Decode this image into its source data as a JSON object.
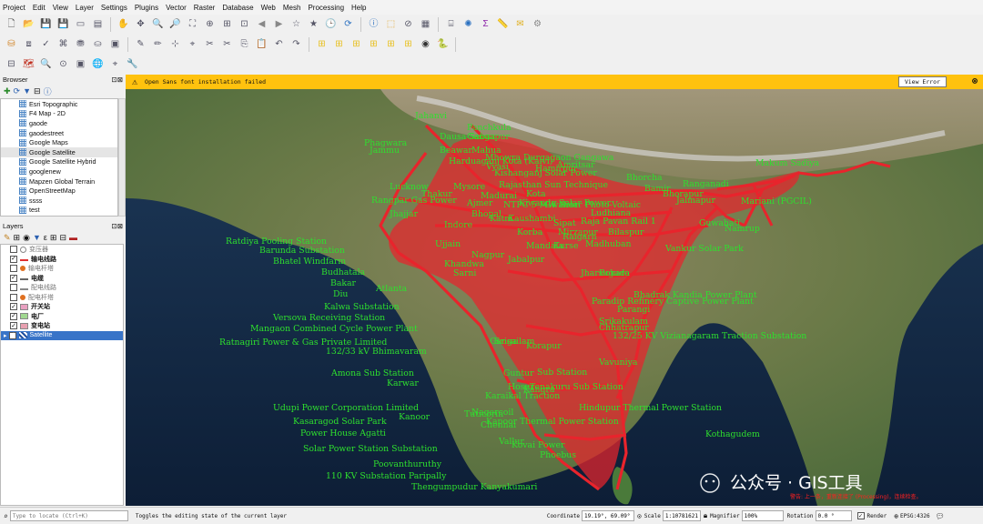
{
  "menubar": [
    "Project",
    "Edit",
    "View",
    "Layer",
    "Settings",
    "Plugins",
    "Vector",
    "Raster",
    "Database",
    "Web",
    "Mesh",
    "Processing",
    "Help"
  ],
  "toolbars": {
    "row1": [
      "new-project-icon",
      "open-project-icon",
      "save-project-icon",
      "save-as-icon",
      "print-layout-icon",
      "layout-manager-icon",
      "sep",
      "pan-icon",
      "pan-to-selection-icon",
      "zoom-in-icon",
      "zoom-out-icon",
      "zoom-full-icon",
      "zoom-to-selection-icon",
      "zoom-to-layer-icon",
      "zoom-native-icon",
      "zoom-last-icon",
      "zoom-next-icon",
      "new-bookmark-icon",
      "show-bookmarks-icon",
      "temporal-controller-icon",
      "refresh-icon",
      "sep",
      "identify-icon",
      "select-features-icon",
      "deselect-icon",
      "attribute-table-icon",
      "sep",
      "field-calculator-icon",
      "statistics-icon",
      "sum-icon",
      "measure-icon",
      "annotation-icon",
      "map-tips-icon"
    ],
    "row2": [
      "data-source-manager-icon",
      "new-geopackage-icon",
      "digitize-icon",
      "new-shapefile-icon",
      "new-spatialite-icon",
      "new-virtual-layer-icon",
      "new-temp-layer-icon",
      "sep",
      "edit-pencil-icon",
      "toggle-editing-icon",
      "add-feature-icon",
      "vertex-tool-icon",
      "delete-selected-icon",
      "cut-icon",
      "copy-icon",
      "paste-icon",
      "undo-icon",
      "redo-icon",
      "sep",
      "label-icon",
      "label-pin-icon",
      "label-move-icon",
      "label-rotate-icon",
      "label-show-icon",
      "label-change-icon",
      "globe-icon",
      "python-icon",
      "sep"
    ],
    "row3": [
      "georeferencer-icon",
      "quickmap-icon",
      "zoom-tool-icon",
      "zoom-fit-icon",
      "select-icon",
      "globe-settings-icon",
      "gps-icon",
      "tools-icon"
    ]
  },
  "message": {
    "text": "Open Sans font installation failed",
    "button": "View Error"
  },
  "browser": {
    "title": "Browser",
    "items": [
      "Esri Topographic",
      "F4 Map - 2D",
      "gaode",
      "gaodestreet",
      "Google Maps",
      "Google Satellite",
      "Google Satellite Hybrid",
      "googlenew",
      "Mapzen Global Terrain",
      "OpenStreetMap",
      "ssss",
      "test"
    ],
    "selected": "Google Satellite"
  },
  "layers": {
    "title": "Layers",
    "items": [
      {
        "name": "变压器",
        "checked": false,
        "symbol": "circle",
        "color": "#888888",
        "dim": true
      },
      {
        "name": "输电线路",
        "checked": true,
        "symbol": "line",
        "color": "#e03030",
        "dim": false
      },
      {
        "name": "输电杆塔",
        "checked": false,
        "symbol": "dot",
        "color": "#e07020",
        "dim": true
      },
      {
        "name": "电缆",
        "checked": true,
        "symbol": "dash",
        "color": "#666666",
        "dim": false
      },
      {
        "name": "配电线路",
        "checked": false,
        "symbol": "line",
        "color": "#888888",
        "dim": true
      },
      {
        "name": "配电杆塔",
        "checked": false,
        "symbol": "dot",
        "color": "#e07020",
        "dim": true
      },
      {
        "name": "开关站",
        "checked": true,
        "symbol": "fill",
        "color": "#e8a0c0",
        "dim": false
      },
      {
        "name": "电厂",
        "checked": true,
        "symbol": "fill",
        "color": "#a0d890",
        "dim": false
      },
      {
        "name": "变电站",
        "checked": true,
        "symbol": "fill",
        "color": "#e8a0b0",
        "dim": false
      },
      {
        "name": "Satellite",
        "checked": true,
        "symbol": "raster",
        "color": "#3070c0",
        "dim": false
      }
    ]
  },
  "map": {
    "labels": [
      "Dausa Sabaa",
      "Panchkula",
      "Phagwara",
      "Jahanvi",
      "Jammu",
      "Harduaganj Kota (Kaivi)",
      "Lucknow",
      "Thakur",
      "Mhowra Durgagaon Gangawa",
      "Kishanganj Solar Power",
      "Rajasthan Sun Technique",
      "Rangpar Gas Power",
      "Jhajjar",
      "Kiwanda Solar Power",
      "Kaushambi",
      "Madhuban",
      "Hamirpur",
      "Bhorcha",
      "Bamir",
      "Bhorapur",
      "Jalmapur",
      "Kurse",
      "Mirzapur",
      "Raja Pavan Rail 1",
      "Makum Sadiya",
      "Mariani (PGCIL)",
      "Namrup",
      "Ranganadi",
      "Vyasi",
      "Ratdiya Pooling Station",
      "Barunda Substation",
      "Bhatel Windfarm",
      "Budhatala",
      "Bakar",
      "Diu",
      "Atlanta",
      "Kalwa Substation",
      "Versova Receiving Station",
      "Mangaon Combined Cycle Power Plant",
      "Ratnagiri Power & Gas Private Limited",
      "132/33 kV Bhimavaram",
      "Amona Sub Station",
      "Karwar",
      "Udupi Power Corporation Limited",
      "Kasaragod Solar Park",
      "Kanoor",
      "Power House Agatti",
      "Solar Power Station Substation",
      "Poovanthuruthy",
      "110 KV Substation Paripally",
      "Thengumpudur Kanyakumari",
      "Sub Station",
      "Tenakuru Sub Station",
      "Hindupur Thermal Power Station",
      "Nagercoil",
      "Kovai Power",
      "Vallur",
      "Phoebus",
      "Kapoor Thermal Power Station",
      "Vavuniya",
      "Srikakulam",
      "Parangi",
      "Paradip Refinery Captive Power Plant",
      "Bhadrak Kandia Power Plant",
      "Vankur Solar Park",
      "Guwahati",
      "Bokaro",
      "Chhatrapur",
      "Jharsuguda",
      "Nagpur",
      "Jabalpur",
      "Katni",
      "Indore",
      "Ujjain",
      "Gwalior",
      "Bhopal",
      "Khandwa",
      "Korba",
      "Sipat",
      "Raigarh",
      "Bilaspur",
      "Mandala",
      "Sarni",
      "132/25 KV Vizianagaram Traction Substation",
      "Korapur",
      "Srisailam",
      "Guntur",
      "Chennai",
      "Karaikal Traction",
      "Hosur",
      "Tuticorin",
      "Kothagudem",
      "Mysore",
      "Madurai",
      "NTPC 5 MW Solar Photo-Voltaic",
      "Ajmer",
      "Kota",
      "Mahua",
      "Beawar",
      "Gangapur",
      "Ganga",
      "Kangra",
      "Amritsar",
      "Ludhiana"
    ],
    "watermark": "公众号 · GIS工具",
    "red_note": "警告: 上一条，重新连接了 (Processing)，连续检查。"
  },
  "status": {
    "locate_placeholder": "Type to locate (Ctrl+K)",
    "message": "Toggles the editing state of the current layer",
    "coordinate_label": "Coordinate",
    "coordinate": "19.19°, 69.09°",
    "scale_label": "Scale",
    "scale": "1:10781621",
    "magnifier_label": "Magnifier",
    "magnifier": "100%",
    "rotation_label": "Rotation",
    "rotation": "0.0 °",
    "render_label": "Render",
    "crs": "EPSG:4326"
  },
  "colors": {
    "accent": "#ffc20e",
    "network": "#e8242c",
    "label": "#2ee02e",
    "satellite_land": "#6b8a4a",
    "ocean": "#12243e"
  }
}
